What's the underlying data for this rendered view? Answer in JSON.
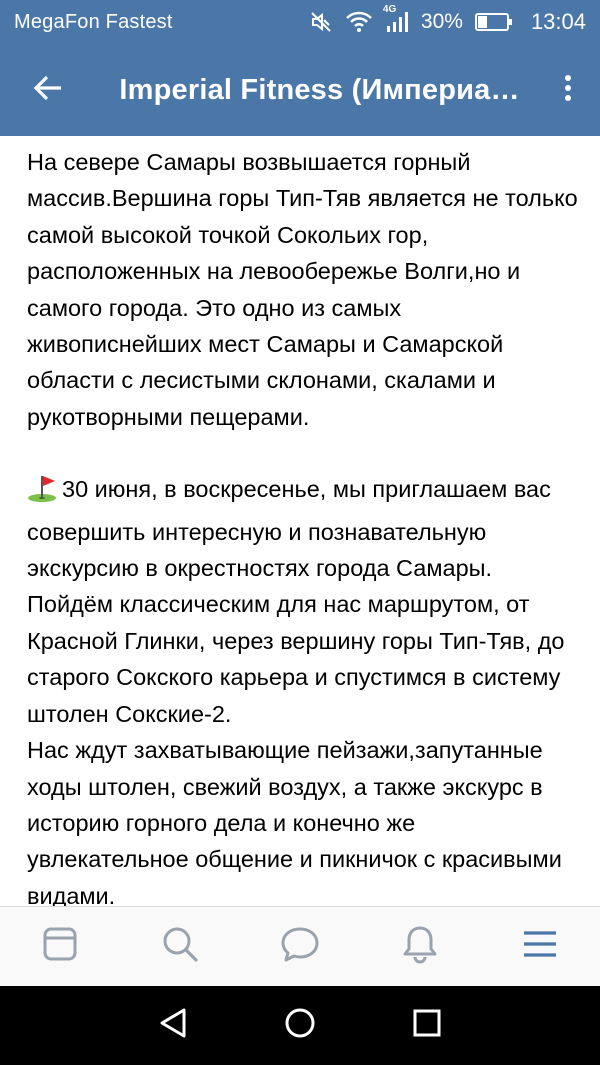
{
  "status_bar": {
    "carrier": "MegaFon Fastest",
    "network": "4G",
    "battery": "30%",
    "time": "13:04"
  },
  "app_bar": {
    "title": "Imperial Fitness (Империал)..."
  },
  "post": {
    "paragraph_1": "На севере Самары возвышается горный массив.Вершина горы Тип-Тяв является не только самой высокой точкой Сокольих гор, расположенных на левообережье Волги,но и самого города. Это одно из самых живописнейших мест Самары и Самарской области с лесистыми склонами, скалами и рукотворными пещерами.",
    "paragraph_2": "30 июня, в воскресенье, мы приглашаем вас совершить интересную и познавательную экскурсию в окрестностях города Самары. Пойдём классическим для нас маршрутом, от Красной Глинки, через вершину горы Тип-Тяв, до старого Сокского карьера и спустимся в систему штолен Сокские-2.",
    "paragraph_3": "Нас ждут захватывающие пейзажи,запутанные ходы штолен, свежий воздух, а также экскурс в историю горного дела и конечно же увлекательное общение и пикничок с красивыми видами."
  },
  "icons": {
    "back": "arrow-left-icon",
    "more": "more-vertical-icon",
    "golf": "golf-flag-emoji",
    "tabs": [
      "news-icon",
      "search-icon",
      "messages-icon",
      "notifications-icon",
      "menu-icon"
    ],
    "nav": [
      "back-triangle-icon",
      "home-circle-icon",
      "recents-square-icon"
    ]
  },
  "colors": {
    "header": "#4a76a8",
    "tab_icon": "#99a2ad",
    "tab_active": "#4a76a8",
    "text": "#000000"
  }
}
